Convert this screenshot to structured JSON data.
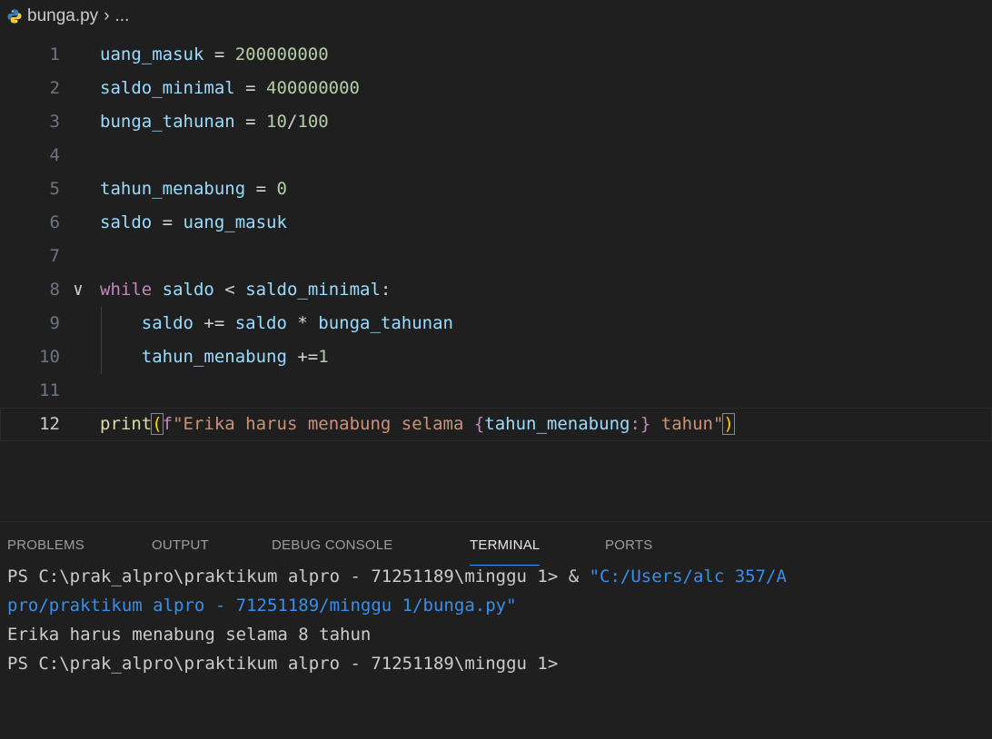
{
  "breadcrumb": {
    "file": "bunga.py",
    "separator": "›",
    "rest": "..."
  },
  "editor": {
    "current_line": 12,
    "lines": [
      {
        "num": "1",
        "tokens": [
          [
            "v",
            "uang_masuk"
          ],
          [
            "o",
            " = "
          ],
          [
            "n",
            "200000000"
          ]
        ]
      },
      {
        "num": "2",
        "tokens": [
          [
            "v",
            "saldo_minimal"
          ],
          [
            "o",
            " = "
          ],
          [
            "n",
            "400000000"
          ]
        ]
      },
      {
        "num": "3",
        "tokens": [
          [
            "v",
            "bunga_tahunan"
          ],
          [
            "o",
            " = "
          ],
          [
            "n",
            "10"
          ],
          [
            "o",
            "/"
          ],
          [
            "n",
            "100"
          ]
        ]
      },
      {
        "num": "4",
        "tokens": []
      },
      {
        "num": "5",
        "tokens": [
          [
            "v",
            "tahun_menabung"
          ],
          [
            "o",
            " = "
          ],
          [
            "n",
            "0"
          ]
        ]
      },
      {
        "num": "6",
        "tokens": [
          [
            "v",
            "saldo"
          ],
          [
            "o",
            " = "
          ],
          [
            "v",
            "uang_masuk"
          ]
        ]
      },
      {
        "num": "7",
        "tokens": []
      },
      {
        "num": "8",
        "fold": "∨",
        "tokens": [
          [
            "k",
            "while"
          ],
          [
            "o",
            " "
          ],
          [
            "v",
            "saldo"
          ],
          [
            "o",
            " < "
          ],
          [
            "v",
            "saldo_minimal"
          ],
          [
            "o",
            ":"
          ]
        ]
      },
      {
        "num": "9",
        "tokens": [
          [
            "o",
            "    "
          ],
          [
            "v",
            "saldo"
          ],
          [
            "o",
            " += "
          ],
          [
            "v",
            "saldo"
          ],
          [
            "o",
            " * "
          ],
          [
            "v",
            "bunga_tahunan"
          ]
        ]
      },
      {
        "num": "10",
        "tokens": [
          [
            "o",
            "    "
          ],
          [
            "v",
            "tahun_menabung"
          ],
          [
            "o",
            " +="
          ],
          [
            "n",
            "1"
          ]
        ]
      },
      {
        "num": "11",
        "tokens": []
      },
      {
        "num": "12",
        "tokens": [
          [
            "f",
            "print"
          ],
          [
            "pb",
            "("
          ],
          [
            "k",
            "f"
          ],
          [
            "s",
            "\"Erika harus menabung selama "
          ],
          [
            "k",
            "{"
          ],
          [
            "v",
            "tahun_menabung"
          ],
          [
            "k",
            ":}"
          ],
          [
            "s",
            " tahun\""
          ],
          [
            "pb",
            ")"
          ]
        ]
      }
    ]
  },
  "panel": {
    "tabs": [
      "PROBLEMS",
      "OUTPUT",
      "DEBUG CONSOLE",
      "TERMINAL",
      "PORTS"
    ],
    "active_tab": "TERMINAL"
  },
  "terminal": {
    "lines": [
      [
        [
          "t",
          "PS C:\\prak_alpro\\praktikum alpro - 71251189\\minggu 1> & "
        ],
        [
          "tstr",
          "\"C:/Users/alc 357/A"
        ]
      ],
      [
        [
          "tstr",
          "pro/praktikum alpro - 71251189/minggu 1/bunga.py\""
        ]
      ],
      [
        [
          "t",
          "Erika harus menabung selama 8 tahun"
        ]
      ],
      [
        [
          "t",
          "PS C:\\prak_alpro\\praktikum alpro - 71251189\\minggu 1>"
        ]
      ]
    ]
  },
  "colors": {
    "background": "#1f1f1f",
    "variable": "#9cdcfe",
    "number": "#b5cea8",
    "keyword": "#c586c0",
    "function": "#dcdcaa",
    "string": "#ce9178",
    "bracket": "#ffd700",
    "active_tab_underline": "#3794ff",
    "terminal_string": "#3b8eea"
  },
  "icons": {
    "file_type": "python-icon",
    "fold": "chevron-down-icon"
  }
}
